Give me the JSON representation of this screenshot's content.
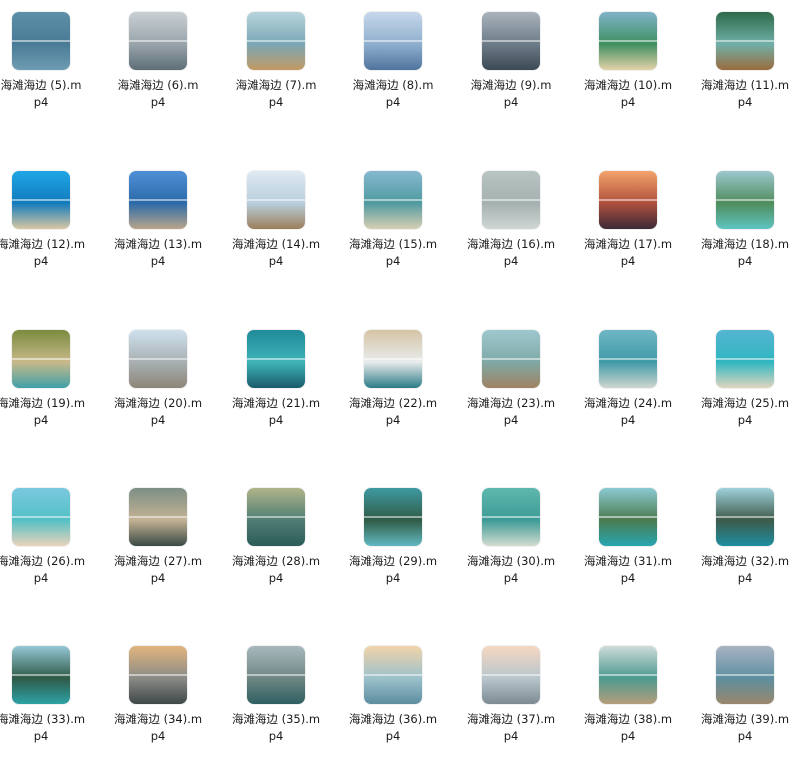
{
  "files": [
    {
      "name_line1": "海滩海边 (5).m",
      "name_line2": "p4",
      "colors": [
        "#5d8fa8",
        "#4a7b96",
        "#6e9cb3"
      ]
    },
    {
      "name_line1": "海滩海边 (6).m",
      "name_line2": "p4",
      "colors": [
        "#c9d0d4",
        "#9aa4ab",
        "#5d6e77"
      ]
    },
    {
      "name_line1": "海滩海边 (7).m",
      "name_line2": "p4",
      "colors": [
        "#b7d4dc",
        "#7aa7b5",
        "#c39a63"
      ]
    },
    {
      "name_line1": "海滩海边 (8).m",
      "name_line2": "p4",
      "colors": [
        "#c7d7ea",
        "#8fb0cf",
        "#4f739c"
      ]
    },
    {
      "name_line1": "海滩海边 (9).m",
      "name_line2": "p4",
      "colors": [
        "#a9b3bc",
        "#6d7c88",
        "#3c4a55"
      ]
    },
    {
      "name_line1": "海滩海边 (10).m",
      "name_line2": "p4",
      "colors": [
        "#7fb3c8",
        "#3f8f62",
        "#e4d2a8"
      ]
    },
    {
      "name_line1": "海滩海边 (11).m",
      "name_line2": "p4",
      "colors": [
        "#2f6a4a",
        "#6fb0a8",
        "#9a6b3e"
      ]
    },
    {
      "name_line1": "海滩海边 (12).m",
      "name_line2": "p4",
      "colors": [
        "#1fa6e6",
        "#137bbd",
        "#d9c7a3"
      ]
    },
    {
      "name_line1": "海滩海边 (13).m",
      "name_line2": "p4",
      "colors": [
        "#4f8fd6",
        "#2b6aa9",
        "#b9a48a"
      ]
    },
    {
      "name_line1": "海滩海边 (14).m",
      "name_line2": "p4",
      "colors": [
        "#dfe9f1",
        "#b8cfdd",
        "#9c7e5c"
      ]
    },
    {
      "name_line1": "海滩海边 (15).m",
      "name_line2": "p4",
      "colors": [
        "#86b8cf",
        "#4f9aa0",
        "#d8cfb2"
      ]
    },
    {
      "name_line1": "海滩海边 (16).m",
      "name_line2": "p4",
      "colors": [
        "#b9c4c3",
        "#a4b1b0",
        "#cfd6d4"
      ]
    },
    {
      "name_line1": "海滩海边 (17).m",
      "name_line2": "p4",
      "colors": [
        "#f3a36a",
        "#b0513e",
        "#3c2a36"
      ]
    },
    {
      "name_line1": "海滩海边 (18).m",
      "name_line2": "p4",
      "colors": [
        "#9dc7cf",
        "#4f8d5c",
        "#5ec5c2"
      ]
    },
    {
      "name_line1": "海滩海边 (19).m",
      "name_line2": "p4",
      "colors": [
        "#7a8b3e",
        "#c9b98a",
        "#3fa0a7"
      ]
    },
    {
      "name_line1": "海滩海边 (20).m",
      "name_line2": "p4",
      "colors": [
        "#cfe1ee",
        "#a8b0b2",
        "#8d8578"
      ]
    },
    {
      "name_line1": "海滩海边 (21).m",
      "name_line2": "p4",
      "colors": [
        "#1f8a9a",
        "#3fb4b8",
        "#1a5b6b"
      ]
    },
    {
      "name_line1": "海滩海边 (22).m",
      "name_line2": "p4",
      "colors": [
        "#d6c3a5",
        "#e8ecec",
        "#2b7b86"
      ]
    },
    {
      "name_line1": "海滩海边 (23).m",
      "name_line2": "p4",
      "colors": [
        "#9ec8cf",
        "#7fa9a6",
        "#9f8262"
      ]
    },
    {
      "name_line1": "海滩海边 (24).m",
      "name_line2": "p4",
      "colors": [
        "#6fb6c5",
        "#3f9aa7",
        "#cfd6cf"
      ]
    },
    {
      "name_line1": "海滩海边 (25).m",
      "name_line2": "p4",
      "colors": [
        "#56b5d2",
        "#2fb6c0",
        "#e0d6bf"
      ]
    },
    {
      "name_line1": "海滩海边 (26).m",
      "name_line2": "p4",
      "colors": [
        "#7ac9de",
        "#53c0c6",
        "#ead3bb"
      ]
    },
    {
      "name_line1": "海滩海边 (27).m",
      "name_line2": "p4",
      "colors": [
        "#7d8f85",
        "#c4b294",
        "#3a4a44"
      ]
    },
    {
      "name_line1": "海滩海边 (28).m",
      "name_line2": "p4",
      "colors": [
        "#b1b48a",
        "#4e7e73",
        "#2c5c58"
      ]
    },
    {
      "name_line1": "海滩海边 (29).m",
      "name_line2": "p4",
      "colors": [
        "#3e9aa2",
        "#2f5b45",
        "#61b9c1"
      ]
    },
    {
      "name_line1": "海滩海边 (30).m",
      "name_line2": "p4",
      "colors": [
        "#5fb8ad",
        "#3c9b96",
        "#d4dcd0"
      ]
    },
    {
      "name_line1": "海滩海边 (31).m",
      "name_line2": "p4",
      "colors": [
        "#8ccad2",
        "#4b7a4f",
        "#27a6b0"
      ]
    },
    {
      "name_line1": "海滩海边 (32).m",
      "name_line2": "p4",
      "colors": [
        "#9fd1dc",
        "#3e5a4a",
        "#1e8ea0"
      ]
    },
    {
      "name_line1": "海滩海边 (33).m",
      "name_line2": "p4",
      "colors": [
        "#95c7d6",
        "#2f5a47",
        "#2ea2a6"
      ]
    },
    {
      "name_line1": "海滩海边 (34).m",
      "name_line2": "p4",
      "colors": [
        "#e1b47d",
        "#8b8c86",
        "#3f4749"
      ]
    },
    {
      "name_line1": "海滩海边 (35).m",
      "name_line2": "p4",
      "colors": [
        "#a9b8bd",
        "#6f8784",
        "#2e5f62"
      ]
    },
    {
      "name_line1": "海滩海边 (36).m",
      "name_line2": "p4",
      "colors": [
        "#f2d3a9",
        "#9cc2cc",
        "#5c8da0"
      ]
    },
    {
      "name_line1": "海滩海边 (37).m",
      "name_line2": "p4",
      "colors": [
        "#f6d7c1",
        "#b9c6cd",
        "#7c8a92"
      ]
    },
    {
      "name_line1": "海滩海边 (38).m",
      "name_line2": "p4",
      "colors": [
        "#cfdbd9",
        "#4c9a8f",
        "#b59e7c"
      ]
    },
    {
      "name_line1": "海滩海边 (39).m",
      "name_line2": "p4",
      "colors": [
        "#a9b3c2",
        "#5d8fa0",
        "#9a876c"
      ]
    }
  ]
}
